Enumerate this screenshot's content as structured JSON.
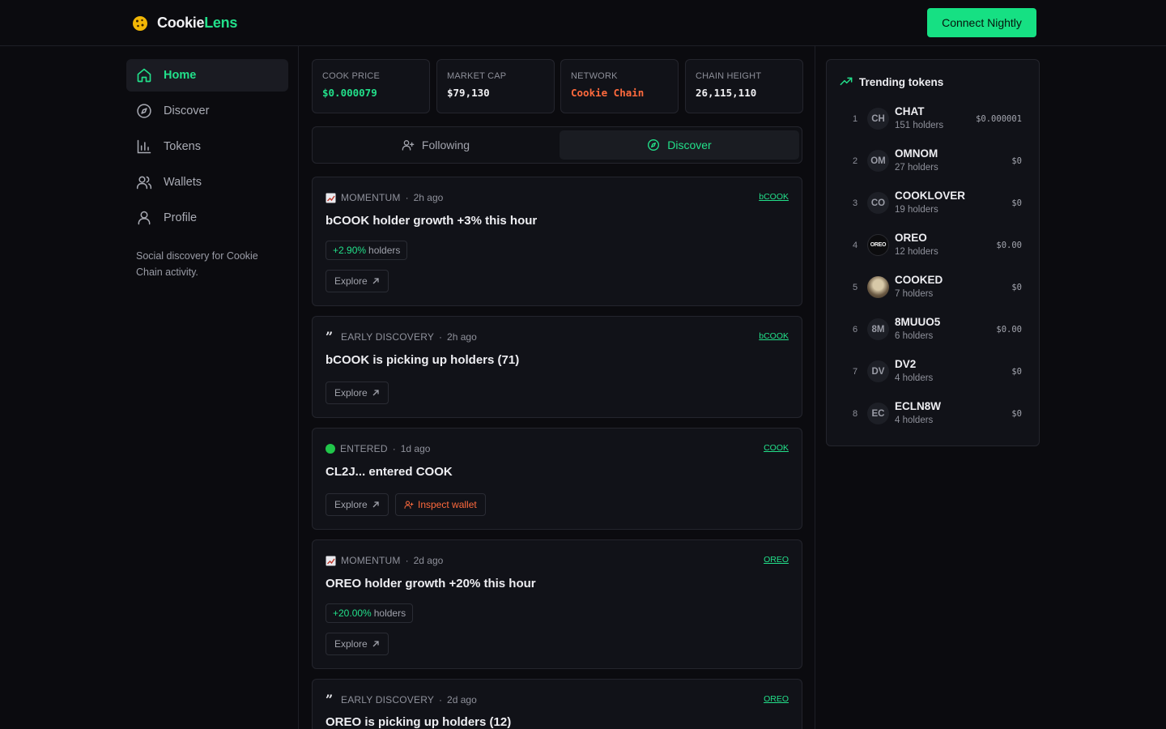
{
  "app": {
    "name_part1": "Cookie",
    "name_part2": "Lens",
    "connect_label": "Connect Nightly"
  },
  "sidebar": {
    "items": [
      {
        "label": "Home",
        "icon": "home-icon",
        "active": true
      },
      {
        "label": "Discover",
        "icon": "compass-icon"
      },
      {
        "label": "Tokens",
        "icon": "bar-chart-icon"
      },
      {
        "label": "Wallets",
        "icon": "users-icon"
      },
      {
        "label": "Profile",
        "icon": "user-icon"
      }
    ],
    "description": "Social discovery for Cookie Chain activity."
  },
  "stats": [
    {
      "label": "COOK PRICE",
      "value": "$0.000079"
    },
    {
      "label": "MARKET CAP",
      "value": "$79,130"
    },
    {
      "label": "NETWORK",
      "value": "Cookie Chain"
    },
    {
      "label": "CHAIN HEIGHT",
      "value": "26,115,110"
    }
  ],
  "tabs": [
    {
      "label": "Following"
    },
    {
      "label": "Discover",
      "active": true
    }
  ],
  "feed": [
    {
      "kind": "MOMENTUM",
      "time": "2h ago",
      "token": "bCOOK",
      "title": "bCOOK holder growth +3% this hour",
      "pill_value": "+2.90%",
      "pill_suffix": "holders",
      "explore": "Explore"
    },
    {
      "kind": "EARLY DISCOVERY",
      "time": "2h ago",
      "token": "bCOOK",
      "title": "bCOOK is picking up holders (71)",
      "explore": "Explore"
    },
    {
      "kind": "ENTERED",
      "time": "1d ago",
      "token": "COOK",
      "title": "CL2J... entered COOK",
      "explore": "Explore",
      "inspect": "Inspect wallet"
    },
    {
      "kind": "MOMENTUM",
      "time": "2d ago",
      "token": "OREO",
      "title": "OREO holder growth +20% this hour",
      "pill_value": "+20.00%",
      "pill_suffix": "holders",
      "explore": "Explore"
    },
    {
      "kind": "EARLY DISCOVERY",
      "time": "2d ago",
      "token": "OREO",
      "title": "OREO is picking up holders (12)"
    }
  ],
  "trending": {
    "title": "Trending tokens",
    "items": [
      {
        "rank": "1",
        "avatar": "CH",
        "symbol": "CHAT",
        "holders": "151 holders",
        "price": "$0.000001"
      },
      {
        "rank": "2",
        "avatar": "OM",
        "symbol": "OMNOM",
        "holders": "27 holders",
        "price": "$0"
      },
      {
        "rank": "3",
        "avatar": "CO",
        "symbol": "COOKLOVER",
        "holders": "19 holders",
        "price": "$0"
      },
      {
        "rank": "4",
        "avatar": "OREO",
        "symbol": "OREO",
        "holders": "12 holders",
        "price": "$0.00"
      },
      {
        "rank": "5",
        "avatar": "",
        "symbol": "COOKED",
        "holders": "7 holders",
        "price": "$0"
      },
      {
        "rank": "6",
        "avatar": "8M",
        "symbol": "8MUUO5",
        "holders": "6 holders",
        "price": "$0.00"
      },
      {
        "rank": "7",
        "avatar": "DV",
        "symbol": "DV2",
        "holders": "4 holders",
        "price": "$0"
      },
      {
        "rank": "8",
        "avatar": "EC",
        "symbol": "ECLN8W",
        "holders": "4 holders",
        "price": "$0"
      }
    ]
  },
  "colors": {
    "accent": "#22e08a",
    "warning": "#ff6a3d",
    "background": "#0b0b0f"
  }
}
